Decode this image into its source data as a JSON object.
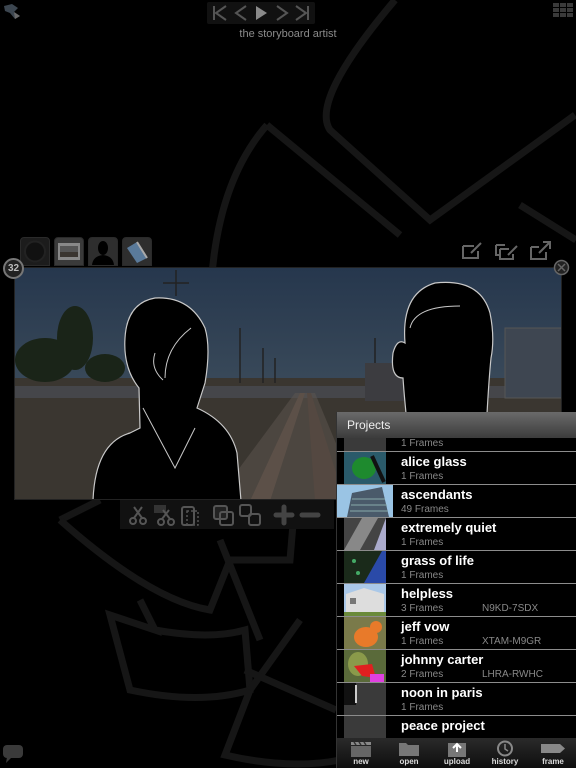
{
  "app": {
    "subtitle": "the storyboard artist",
    "transport": [
      "first-frame",
      "previous-frame",
      "play",
      "next-frame",
      "last-frame"
    ]
  },
  "frame": {
    "number": "32",
    "layers": [
      "background-layer-empty",
      "photo-layer",
      "character-layer",
      "paint-layer"
    ],
    "actions": [
      "edit-note",
      "duplicate-edit",
      "export"
    ]
  },
  "edit_toolbar": [
    "cut",
    "cut-selection",
    "paste",
    "copy",
    "duplicate",
    "add",
    "remove"
  ],
  "projects": {
    "title": "Projects",
    "items": [
      {
        "name": "",
        "frames": "1 Frames",
        "code": "",
        "thumb": "gray"
      },
      {
        "name": "alice glass",
        "frames": "1 Frames",
        "code": "",
        "thumb": "green"
      },
      {
        "name": "ascendants",
        "frames": "49 Frames",
        "code": "",
        "thumb": "building"
      },
      {
        "name": "extremely quiet",
        "frames": "1 Frames",
        "code": "",
        "thumb": "diagonal"
      },
      {
        "name": "grass of life",
        "frames": "1 Frames",
        "code": "",
        "thumb": "blue"
      },
      {
        "name": "helpless",
        "frames": "3 Frames",
        "code": "N9KD-7SDX",
        "thumb": "house"
      },
      {
        "name": "jeff vow",
        "frames": "1 Frames",
        "code": "XTAM-M9GR",
        "thumb": "orange"
      },
      {
        "name": "johnny carter",
        "frames": "2 Frames",
        "code": "LHRA-RWHC",
        "thumb": "magenta"
      },
      {
        "name": "noon in paris",
        "frames": "1 Frames",
        "code": "",
        "thumb": "dark"
      },
      {
        "name": "peace project",
        "frames": "",
        "code": "",
        "thumb": "gray"
      }
    ],
    "toolbar": [
      {
        "label": "new",
        "icon": "clapperboard-icon"
      },
      {
        "label": "open",
        "icon": "folder-icon"
      },
      {
        "label": "upload",
        "icon": "upload-icon"
      },
      {
        "label": "history",
        "icon": "clock-icon"
      },
      {
        "label": "frame",
        "icon": "tag-icon"
      }
    ]
  },
  "colors": {
    "background": "#000000",
    "sky": "#2e4159",
    "header_top": "#6a6a6a",
    "header_bottom": "#3c3c3c"
  }
}
